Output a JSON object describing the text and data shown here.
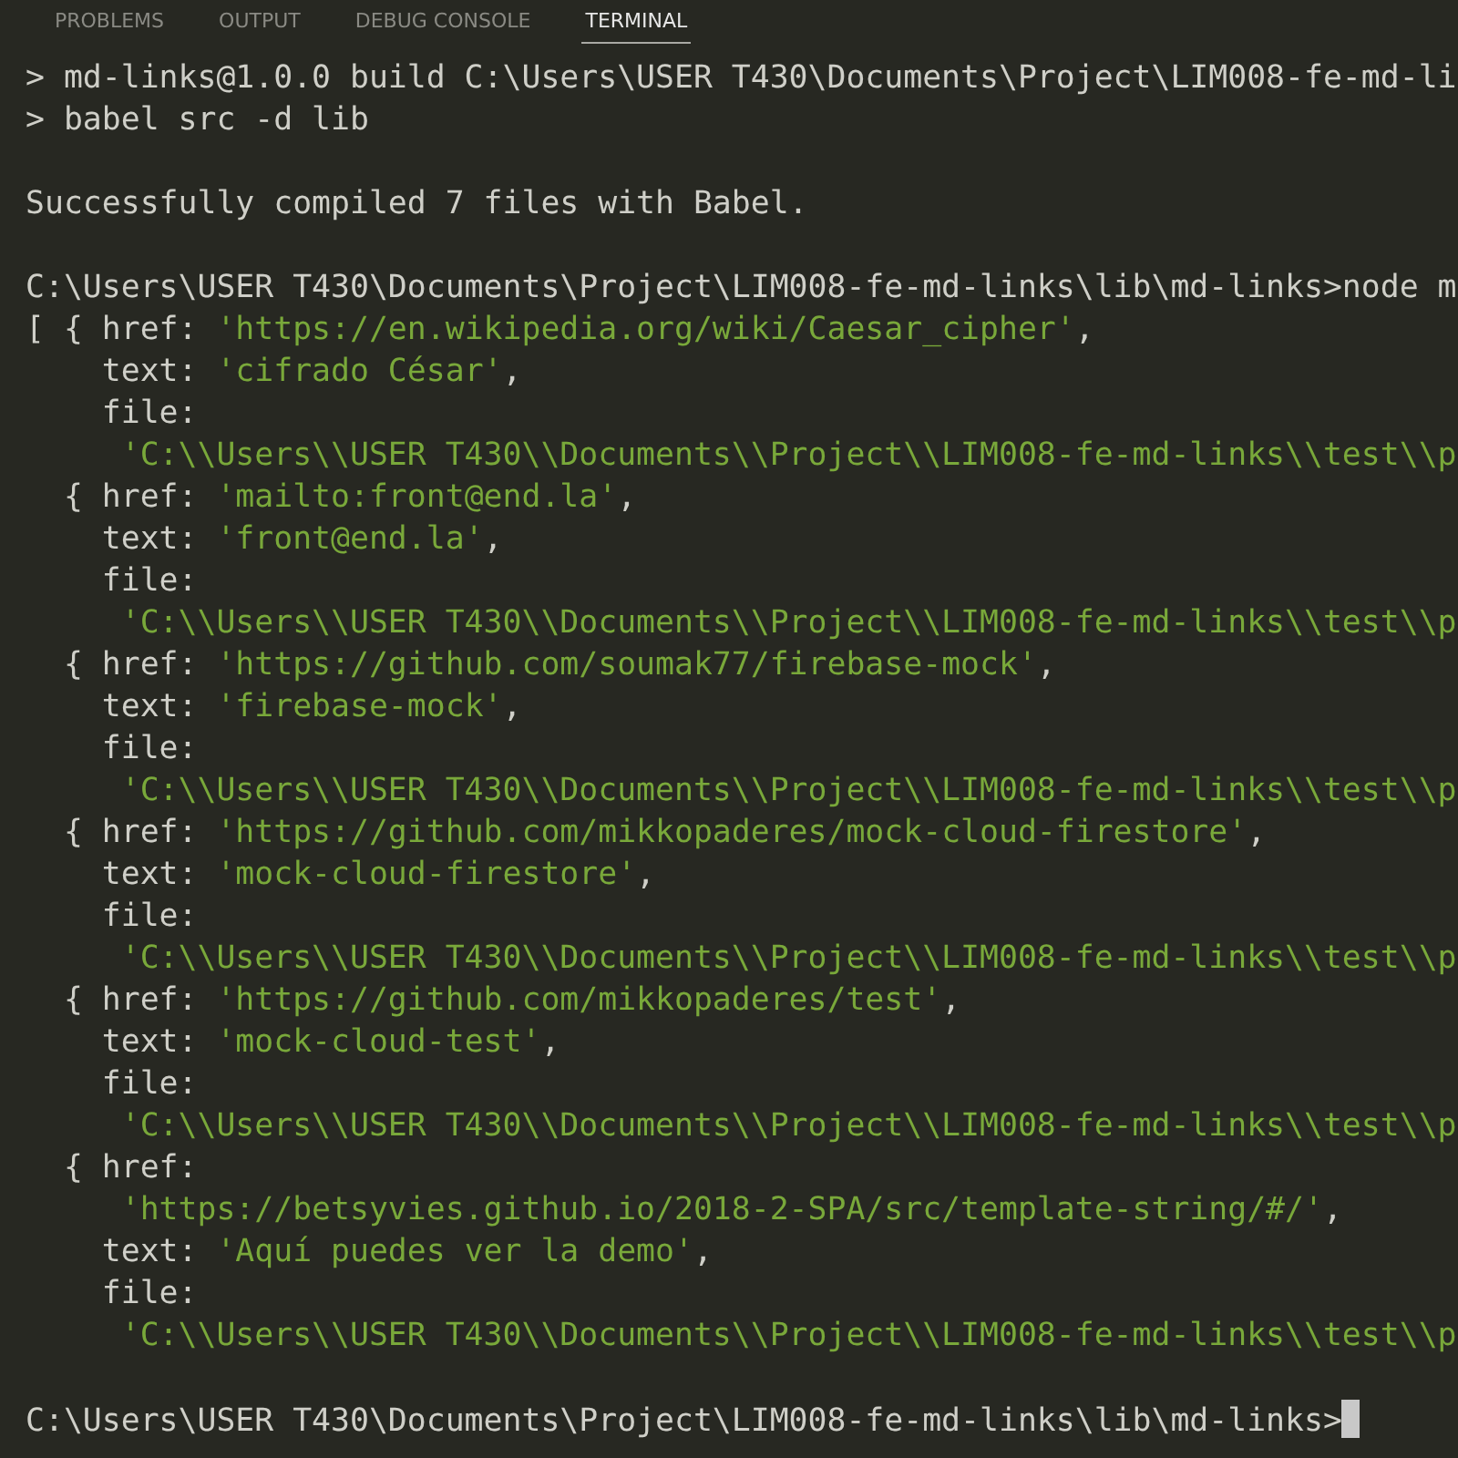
{
  "tabs": [
    {
      "label": "PROBLEMS",
      "selected": false
    },
    {
      "label": "OUTPUT",
      "selected": false
    },
    {
      "label": "DEBUG CONSOLE",
      "selected": false
    },
    {
      "label": "TERMINAL",
      "selected": true
    }
  ],
  "terminal": {
    "lines": [
      {
        "parts": [
          {
            "kind": "plain",
            "text": "> md-links@1.0.0 build C:\\Users\\USER T430\\Documents\\Project\\LIM008-fe-md-li"
          }
        ]
      },
      {
        "parts": [
          {
            "kind": "plain",
            "text": "> babel src -d lib"
          }
        ]
      },
      {
        "gap_before": true,
        "parts": [
          {
            "kind": "plain",
            "text": "Successfully compiled 7 files with Babel."
          }
        ]
      },
      {
        "gap_before": true,
        "parts": [
          {
            "kind": "plain",
            "text": "C:\\Users\\USER T430\\Documents\\Project\\LIM008-fe-md-links\\lib\\md-links>node m"
          }
        ]
      },
      {
        "parts": [
          {
            "kind": "plain",
            "text": "[ { href: "
          },
          {
            "kind": "string",
            "text": "'https://en.wikipedia.org/wiki/Caesar_cipher'"
          },
          {
            "kind": "plain",
            "text": ","
          }
        ]
      },
      {
        "parts": [
          {
            "kind": "plain",
            "text": "    text: "
          },
          {
            "kind": "string",
            "text": "'cifrado César'"
          },
          {
            "kind": "plain",
            "text": ","
          }
        ]
      },
      {
        "parts": [
          {
            "kind": "plain",
            "text": "    file:"
          }
        ]
      },
      {
        "parts": [
          {
            "kind": "string",
            "text": "     'C:\\\\Users\\\\USER T430\\\\Documents\\\\Project\\\\LIM008-fe-md-links\\\\test\\\\p"
          }
        ]
      },
      {
        "parts": [
          {
            "kind": "plain",
            "text": "  { href: "
          },
          {
            "kind": "string",
            "text": "'mailto:front@end.la'"
          },
          {
            "kind": "plain",
            "text": ","
          }
        ]
      },
      {
        "parts": [
          {
            "kind": "plain",
            "text": "    text: "
          },
          {
            "kind": "string",
            "text": "'front@end.la'"
          },
          {
            "kind": "plain",
            "text": ","
          }
        ]
      },
      {
        "parts": [
          {
            "kind": "plain",
            "text": "    file:"
          }
        ]
      },
      {
        "parts": [
          {
            "kind": "string",
            "text": "     'C:\\\\Users\\\\USER T430\\\\Documents\\\\Project\\\\LIM008-fe-md-links\\\\test\\\\p"
          }
        ]
      },
      {
        "parts": [
          {
            "kind": "plain",
            "text": "  { href: "
          },
          {
            "kind": "string",
            "text": "'https://github.com/soumak77/firebase-mock'"
          },
          {
            "kind": "plain",
            "text": ","
          }
        ]
      },
      {
        "parts": [
          {
            "kind": "plain",
            "text": "    text: "
          },
          {
            "kind": "string",
            "text": "'firebase-mock'"
          },
          {
            "kind": "plain",
            "text": ","
          }
        ]
      },
      {
        "parts": [
          {
            "kind": "plain",
            "text": "    file:"
          }
        ]
      },
      {
        "parts": [
          {
            "kind": "string",
            "text": "     'C:\\\\Users\\\\USER T430\\\\Documents\\\\Project\\\\LIM008-fe-md-links\\\\test\\\\p"
          }
        ]
      },
      {
        "parts": [
          {
            "kind": "plain",
            "text": "  { href: "
          },
          {
            "kind": "string",
            "text": "'https://github.com/mikkopaderes/mock-cloud-firestore'"
          },
          {
            "kind": "plain",
            "text": ","
          }
        ]
      },
      {
        "parts": [
          {
            "kind": "plain",
            "text": "    text: "
          },
          {
            "kind": "string",
            "text": "'mock-cloud-firestore'"
          },
          {
            "kind": "plain",
            "text": ","
          }
        ]
      },
      {
        "parts": [
          {
            "kind": "plain",
            "text": "    file:"
          }
        ]
      },
      {
        "parts": [
          {
            "kind": "string",
            "text": "     'C:\\\\Users\\\\USER T430\\\\Documents\\\\Project\\\\LIM008-fe-md-links\\\\test\\\\p"
          }
        ]
      },
      {
        "parts": [
          {
            "kind": "plain",
            "text": "  { href: "
          },
          {
            "kind": "string",
            "text": "'https://github.com/mikkopaderes/test'"
          },
          {
            "kind": "plain",
            "text": ","
          }
        ]
      },
      {
        "parts": [
          {
            "kind": "plain",
            "text": "    text: "
          },
          {
            "kind": "string",
            "text": "'mock-cloud-test'"
          },
          {
            "kind": "plain",
            "text": ","
          }
        ]
      },
      {
        "parts": [
          {
            "kind": "plain",
            "text": "    file:"
          }
        ]
      },
      {
        "parts": [
          {
            "kind": "string",
            "text": "     'C:\\\\Users\\\\USER T430\\\\Documents\\\\Project\\\\LIM008-fe-md-links\\\\test\\\\p"
          }
        ]
      },
      {
        "parts": [
          {
            "kind": "plain",
            "text": "  { href:"
          }
        ]
      },
      {
        "parts": [
          {
            "kind": "string",
            "text": "     'https://betsyvies.github.io/2018-2-SPA/src/template-string/#/'"
          },
          {
            "kind": "plain",
            "text": ","
          }
        ]
      },
      {
        "parts": [
          {
            "kind": "plain",
            "text": "    text: "
          },
          {
            "kind": "string",
            "text": "'Aquí puedes ver la demo'"
          },
          {
            "kind": "plain",
            "text": ","
          }
        ]
      },
      {
        "parts": [
          {
            "kind": "plain",
            "text": "    file:"
          }
        ]
      },
      {
        "parts": [
          {
            "kind": "string",
            "text": "     'C:\\\\Users\\\\USER T430\\\\Documents\\\\Project\\\\LIM008-fe-md-links\\\\test\\\\p"
          }
        ]
      },
      {
        "gap_before": true,
        "cursor": true,
        "parts": [
          {
            "kind": "plain",
            "text": "C:\\Users\\USER T430\\Documents\\Project\\LIM008-fe-md-links\\lib\\md-links>"
          }
        ]
      }
    ]
  }
}
